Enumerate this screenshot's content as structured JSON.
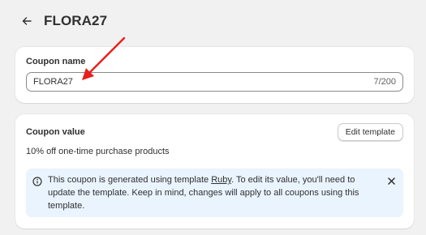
{
  "header": {
    "title": "FLORA27",
    "back_icon": "arrow-left-icon"
  },
  "coupon_name_card": {
    "label": "Coupon name",
    "input_value": "FLORA27",
    "char_count": "7/200"
  },
  "coupon_value_card": {
    "label": "Coupon value",
    "edit_button_label": "Edit template",
    "description": "10% off one-time purchase products",
    "banner": {
      "icon": "info-icon",
      "text_before": "This coupon is generated using template ",
      "link_text": "Ruby",
      "text_after": ". To edit its value, you'll need to update the template. Keep in mind, changes will apply to all coupons using this template.",
      "close_icon": "close-icon",
      "background_color": "#eaf4ff"
    }
  },
  "annotation": {
    "arrow_color": "#e8201c"
  }
}
